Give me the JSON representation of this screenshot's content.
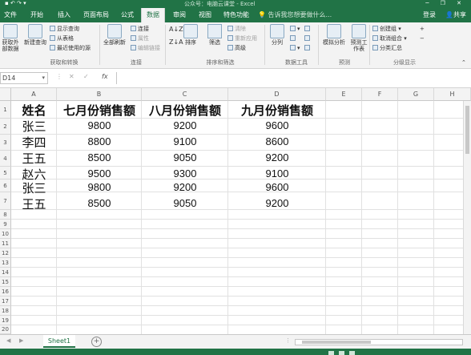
{
  "title_bar": {
    "title": "公众号：电脑云课堂 - Excel",
    "window_buttons": "─ ❐ ✕"
  },
  "tabs": [
    "文件",
    "开始",
    "插入",
    "页面布局",
    "公式",
    "数据",
    "审阅",
    "视图",
    "特色功能"
  ],
  "active_tab": "数据",
  "tell_me": "告诉我您想要做什么...",
  "sign_in": "登录",
  "share": "共享",
  "ribbon": {
    "get_external": "获取外部数据",
    "new_query": "新建查询",
    "show_queries": "显示查询",
    "from_table": "从表格",
    "recent_sources": "最近使用的源",
    "group_get_transform": "获取和转换",
    "refresh_all": "全部刷新",
    "connections": "连接",
    "properties": "属性",
    "edit_links": "编辑链接",
    "group_connections": "连接",
    "sort": "排序",
    "filter": "筛选",
    "clear": "清除",
    "reapply": "重新应用",
    "advanced": "高级",
    "group_sort_filter": "排序和筛选",
    "split": "分列",
    "group_data_tools": "数据工具",
    "what_if": "模拟分析",
    "forecast_sheet": "预测工作表",
    "group_forecast": "预测",
    "group": "创建组",
    "ungroup": "取消组合",
    "subtotal": "分类汇总",
    "group_outline": "分级显示"
  },
  "formula_bar": {
    "name_box": "D14",
    "cancel": "✕",
    "enter": "✓",
    "fx": "fx",
    "value": ""
  },
  "columns": [
    "A",
    "B",
    "C",
    "D",
    "E",
    "F",
    "G",
    "H"
  ],
  "rows": [
    "1",
    "2",
    "3",
    "4",
    "5",
    "6",
    "7",
    "8",
    "9",
    "10",
    "11",
    "12",
    "13",
    "14",
    "15",
    "16",
    "17",
    "18",
    "19",
    "20"
  ],
  "table": {
    "headers": [
      "姓名",
      "七月份销售额",
      "八月份销售额",
      "九月份销售额"
    ],
    "rows": [
      [
        "张三",
        "9800",
        "9200",
        "9600"
      ],
      [
        "李四",
        "8800",
        "9100",
        "8600"
      ],
      [
        "王五",
        "8500",
        "9050",
        "9200"
      ],
      [
        "赵六",
        "9500",
        "9300",
        "9100"
      ],
      [
        "张三",
        "9800",
        "9200",
        "9600"
      ],
      [
        "王五",
        "8500",
        "9050",
        "9200"
      ]
    ]
  },
  "sheet_tab": "Sheet1",
  "add_sheet": "+",
  "colors": {
    "accent": "#217346",
    "ribbon_bg": "#f3f3f3",
    "gridline": "#e1e1e1"
  }
}
